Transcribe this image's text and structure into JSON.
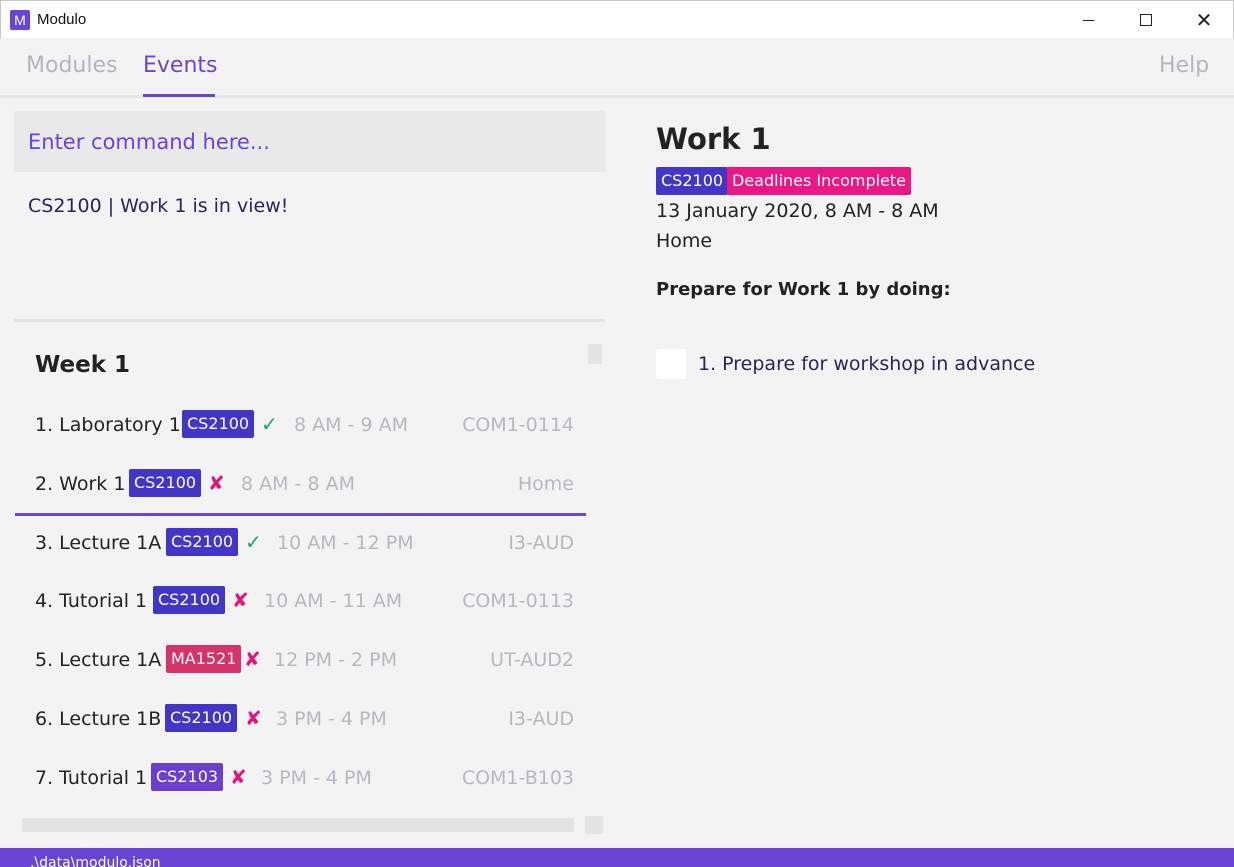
{
  "window": {
    "title": "Modulo",
    "icon_letter": "M"
  },
  "tabs": [
    {
      "label": "Modules",
      "active": false
    },
    {
      "label": "Events",
      "active": true
    }
  ],
  "help_label": "Help",
  "command": {
    "placeholder": "Enter command here...",
    "value": ""
  },
  "result_message": "CS2100 | Work 1 is in view!",
  "list": {
    "week_title": "Week 1",
    "rows": [
      {
        "name": "1. Laboratory 1",
        "tag": "CS2100",
        "tag_color": "#4236c8",
        "status": "✓",
        "status_color": "#1aa37a",
        "time": "8 AM - 9 AM",
        "venue": "COM1-0114"
      },
      {
        "name": "2. Work 1",
        "tag": "CS2100",
        "tag_color": "#4236c8",
        "status": "✘",
        "status_color": "#e0157d",
        "time": "8 AM - 8 AM",
        "venue": "Home",
        "selected": true
      },
      {
        "name": "3. Lecture 1A",
        "tag": "CS2100",
        "tag_color": "#4236c8",
        "status": "✓",
        "status_color": "#1aa37a",
        "time": "10 AM - 12 PM",
        "venue": "I3-AUD"
      },
      {
        "name": "4. Tutorial 1",
        "tag": "CS2100",
        "tag_color": "#4236c8",
        "status": "✘",
        "status_color": "#e0157d",
        "time": "10 AM - 11 AM",
        "venue": "COM1-0113"
      },
      {
        "name": "5. Lecture 1A",
        "tag": "MA1521",
        "tag_color": "#d7336b",
        "status": "✘",
        "status_color": "#e0157d",
        "time": "12 PM - 2 PM",
        "venue": "UT-AUD2"
      },
      {
        "name": "6. Lecture 1B",
        "tag": "CS2100",
        "tag_color": "#4236c8",
        "status": "✘",
        "status_color": "#e0157d",
        "time": "3 PM - 4 PM",
        "venue": "I3-AUD"
      },
      {
        "name": "7. Tutorial 1",
        "tag": "CS2103",
        "tag_color": "#6a3fce",
        "status": "✘",
        "status_color": "#e0157d",
        "time": "3 PM - 4 PM",
        "venue": "COM1-B103"
      }
    ]
  },
  "detail": {
    "title": "Work 1",
    "module_tag": "CS2100",
    "module_tag_color": "#4236c8",
    "status_tag": "Deadlines Incomplete",
    "status_tag_color": "#ea1784",
    "when": "13 January 2020, 8 AM - 8 AM",
    "where": "Home",
    "prep_heading": "Prepare for Work 1 by doing:",
    "tasks": [
      {
        "label": "1. Prepare for workshop in advance",
        "done": false
      }
    ]
  },
  "statusbar": {
    "path": ".\\data\\modulo.json"
  },
  "colors": {
    "accent": "#6a44d4",
    "tab_inactive": "#b4b4c2"
  }
}
